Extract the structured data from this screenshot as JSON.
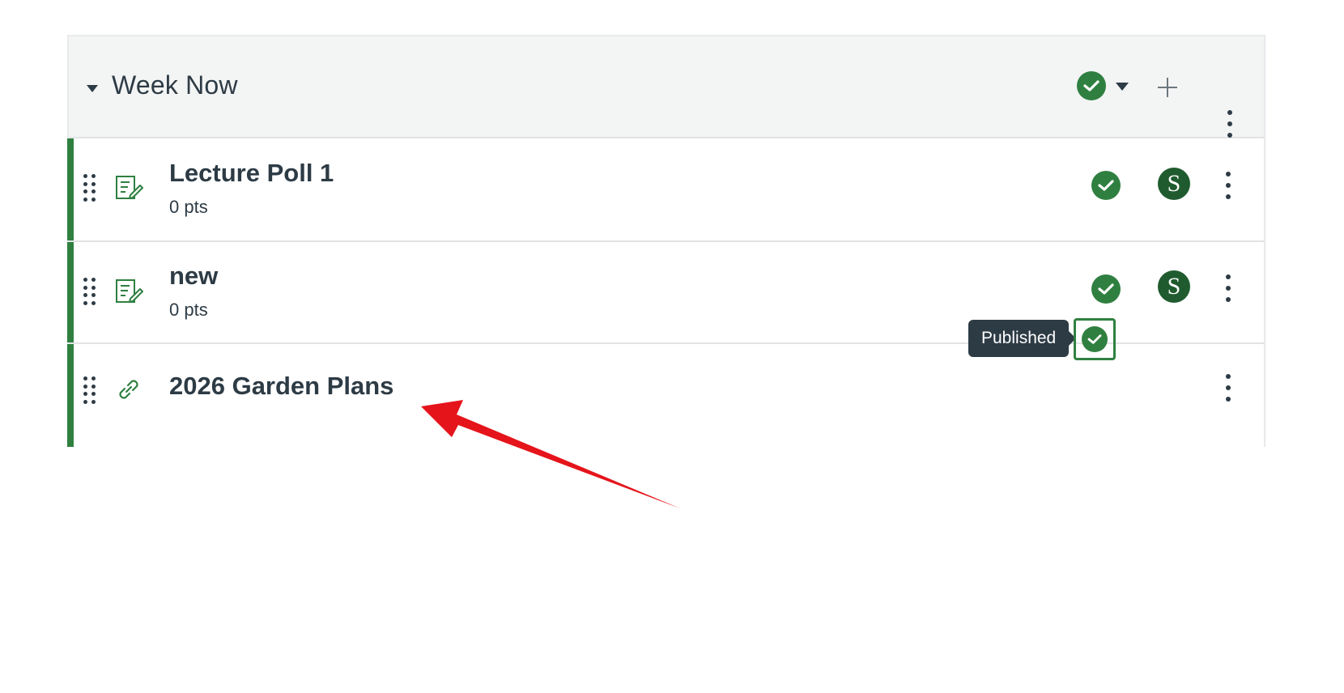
{
  "module": {
    "title": "Week Now",
    "items": [
      {
        "title": "Lecture Poll 1",
        "points": "0 pts",
        "type_icon": "quiz-icon",
        "avatar_letter": "S"
      },
      {
        "title": "new",
        "points": "0 pts",
        "type_icon": "quiz-icon",
        "avatar_letter": "S"
      },
      {
        "title": "2026 Garden Plans",
        "type_icon": "link-icon"
      }
    ]
  },
  "tooltip": {
    "text": "Published"
  },
  "colors": {
    "published_green": "#2f8040",
    "avatar_green": "#1f5b2e",
    "annotation_red": "#e5141b",
    "text_dark": "#2d3b45"
  }
}
